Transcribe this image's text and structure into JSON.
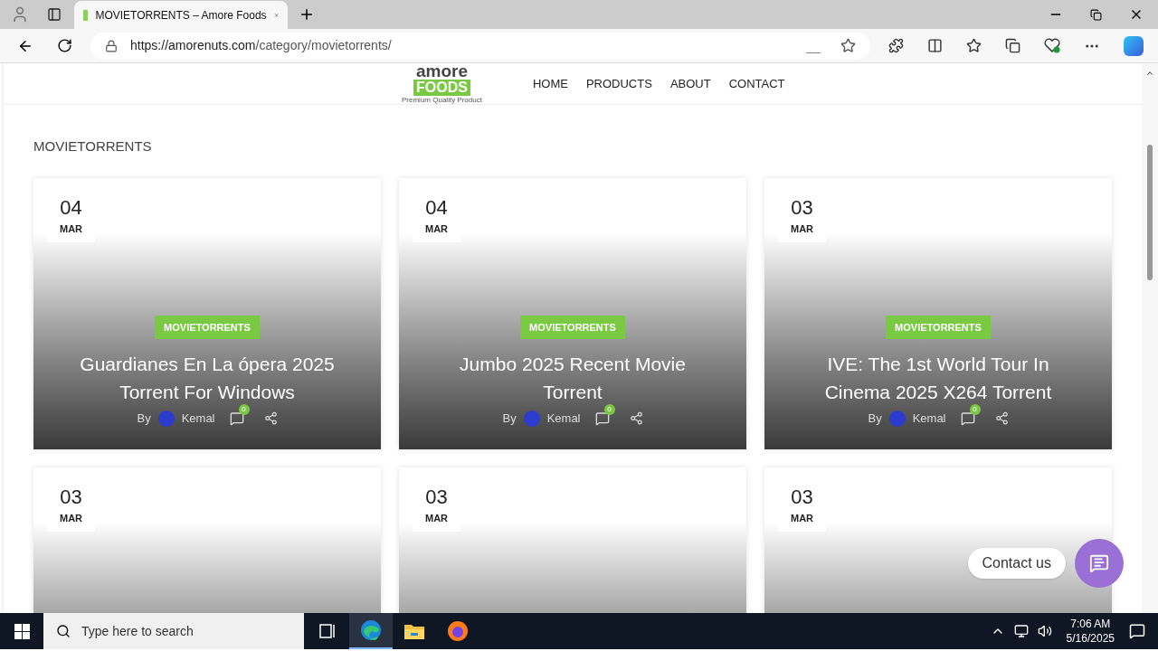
{
  "browser": {
    "tab_title": "MOVIETORRENTS – Amore Foods",
    "url_host": "https://amorenuts.com",
    "url_path": "/category/movietorrents/"
  },
  "site": {
    "logo": {
      "word": "amore",
      "band": "FOODS",
      "tagline": "Premium Quality Product"
    },
    "nav": [
      {
        "label": "HOME"
      },
      {
        "label": "PRODUCTS"
      },
      {
        "label": "ABOUT"
      },
      {
        "label": "CONTACT"
      }
    ]
  },
  "category_heading": "MOVIETORRENTS",
  "posts": [
    {
      "day": "04",
      "month": "MAR",
      "category": "MOVIETORRENTS",
      "title": "Guardianes En La ópera 2025 Torrent For Windows",
      "by": "By",
      "author": "Kemal",
      "comments": "0"
    },
    {
      "day": "04",
      "month": "MAR",
      "category": "MOVIETORRENTS",
      "title": "Jumbo 2025 Recent Movie Torrent",
      "by": "By",
      "author": "Kemal",
      "comments": "0"
    },
    {
      "day": "03",
      "month": "MAR",
      "category": "MOVIETORRENTS",
      "title": "IVE: The 1st World Tour In Cinema 2025 X264 Torrent",
      "by": "By",
      "author": "Kemal",
      "comments": "0"
    },
    {
      "day": "03",
      "month": "MAR"
    },
    {
      "day": "03",
      "month": "MAR"
    },
    {
      "day": "03",
      "month": "MAR"
    }
  ],
  "contact_widget": {
    "label": "Contact us"
  },
  "taskbar": {
    "search_placeholder": "Type here to search",
    "apps": [
      {
        "kind": "taskview",
        "selected": false
      },
      {
        "kind": "edge",
        "selected": true
      },
      {
        "kind": "explorer",
        "selected": false
      },
      {
        "kind": "firefox",
        "selected": false
      }
    ],
    "time": "7:06 AM",
    "date": "5/16/2025"
  }
}
